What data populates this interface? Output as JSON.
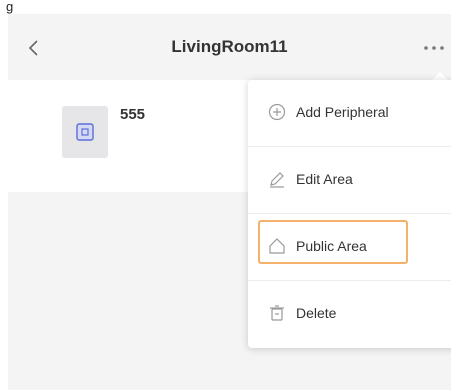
{
  "top_strip_text": "g    ",
  "header": {
    "title": "LivingRoom11"
  },
  "device": {
    "name": "555"
  },
  "menu": {
    "items": [
      {
        "label": "Add Peripheral",
        "icon": "plus-circle-icon"
      },
      {
        "label": "Edit Area",
        "icon": "pencil-icon"
      },
      {
        "label": "Public Area",
        "icon": "home-icon"
      },
      {
        "label": "Delete",
        "icon": "trash-icon"
      }
    ]
  },
  "colors": {
    "background": "#f4f4f4",
    "panel": "#ffffff",
    "highlight_border": "#f3b16b",
    "text": "#333333",
    "icon_gray": "#9a9a9a",
    "device_icon_blue": "#5b6fd6"
  }
}
